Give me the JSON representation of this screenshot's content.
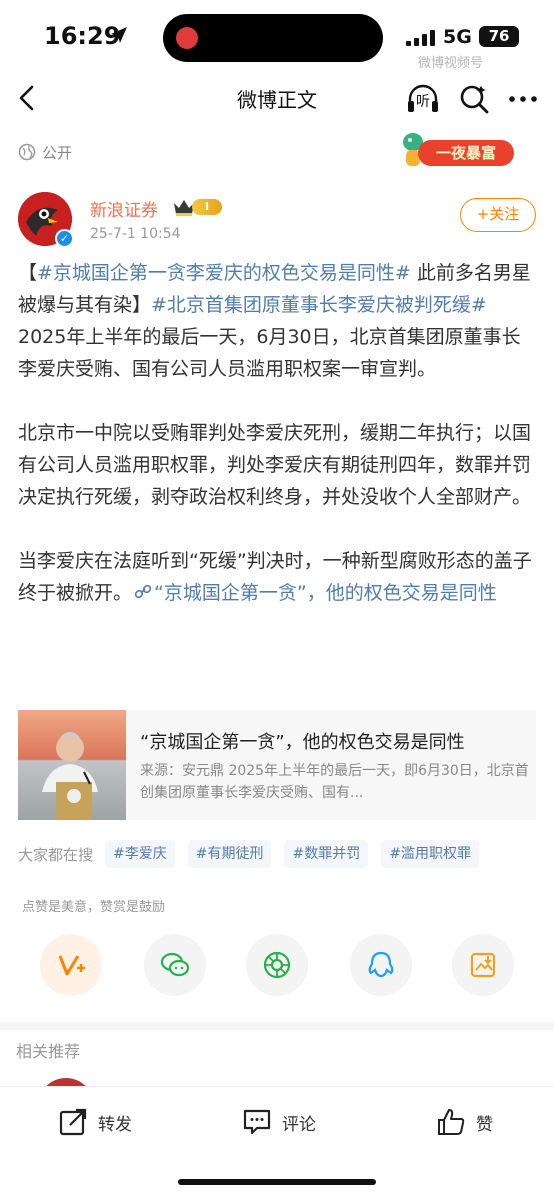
{
  "status_bar": {
    "time": "16:29",
    "network": "5G",
    "battery": "76",
    "watermark": "微博视频号"
  },
  "nav": {
    "title": "微博正文",
    "listen_label": "听"
  },
  "post": {
    "visibility": "公开",
    "promo_label": "一夜暴富",
    "author": {
      "name": "新浪证券",
      "level": "I",
      "time": "25-7-1 10:54",
      "follow_label": "+关注"
    },
    "paragraphs": [
      {
        "t1": "【",
        "topic1": "#京城国企第一贪李爱庆的权色交易是同性#",
        "t2": " 此前多名男星被爆与其有染】",
        "topic2": "#北京首集团原董事长李爱庆被判死缓#",
        "t3": " 2025年上半年的最后一天，6月30日，北京首集团原董事长李爱庆受贿、国有公司人员滥用职权案一审宣判。"
      },
      {
        "text": "北京市一中院以受贿罪判处李爱庆死刑，缓期二年执行；以国有公司人员滥用职权罪，判处李爱庆有期徒刑四年，数罪并罚决定执行死缓，剥夺政治权利终身，并处没收个人全部财产。"
      },
      {
        "text": "当李爱庆在法庭听到“死缓”判决时，一种新型腐败形态的盖子终于被掀开。",
        "link": "“京城国企第一贪”，他的权色交易是同性"
      }
    ],
    "card": {
      "title": "“京城国企第一贪”，他的权色交易是同性",
      "desc": "来源：安元鼎 2025年上半年的最后一天，即6月30日，北京首创集团原董事长李爱庆受贿、国有..."
    }
  },
  "hot_search": {
    "label": "大家都在搜",
    "tags": [
      "#李爱庆",
      "#有期徒刑",
      "#数罪并罚",
      "#滥用职权罪"
    ]
  },
  "appreciate_text": "点赞是美意，赞赏是鼓励",
  "share_targets": [
    "weibo-vplus",
    "wechat",
    "moments",
    "qq",
    "save-image"
  ],
  "related_label": "相关推荐",
  "bottom_bar": {
    "repost": "转发",
    "comment": "评论",
    "like": "赞"
  },
  "colors": {
    "link": "#507daf",
    "author_name": "#eb7350",
    "follow": "#ff8200",
    "promo": "#e8412c"
  }
}
